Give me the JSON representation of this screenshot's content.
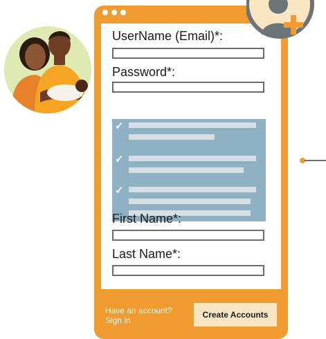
{
  "form": {
    "username_label": "UserName (Email)*:",
    "password_label": "Password*:",
    "first_name_label": "First Name*:",
    "last_name_label": "Last Name*:"
  },
  "footer": {
    "have_account_line1": "Have an account?",
    "have_account_line2": "Sign in",
    "create_button": "Create Accounts"
  },
  "icons": {
    "family": "family-illustration-icon",
    "add_user": "add-user-icon",
    "check": "checkmark-icon"
  },
  "colors": {
    "orange": "#ef9b2f",
    "checklist_blue": "#8eb2c4",
    "button_cream": "#fbe6c3",
    "circle_green": "#dfeab3",
    "badge_gray": "#6d7478"
  }
}
